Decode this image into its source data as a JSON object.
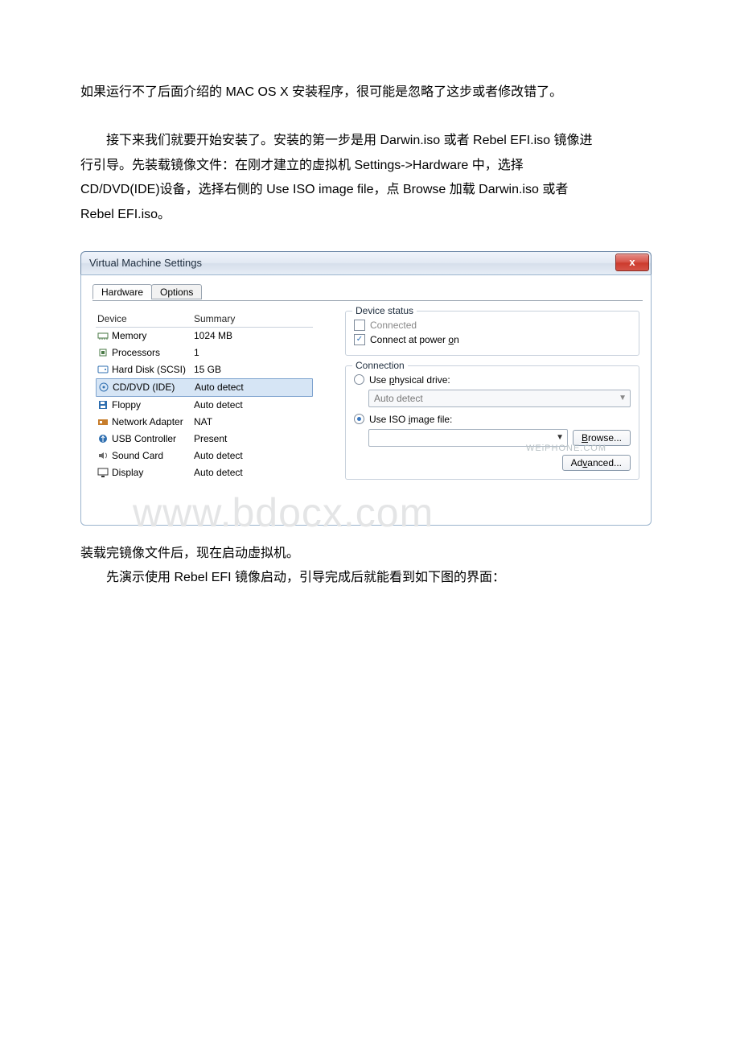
{
  "paragraphs": {
    "p1": "如果运行不了后面介绍的 MAC OS X 安装程序，很可能是忽略了这步或者修改错了。",
    "p2": "接下来我们就要开始安装了。安装的第一步是用 Darwin.iso 或者 Rebel EFI.iso 镜像进行引导。先装载镜像文件：在刚才建立的虚拟机 Settings->Hardware 中，选择 CD/DVD(IDE)设备，选择右侧的 Use ISO image file，点 Browse 加载 Darwin.iso 或者 Rebel EFI.iso。",
    "p3": "装载完镜像文件后，现在启动虚拟机。",
    "p4": "先演示使用 Rebel EFI 镜像启动，引导完成后就能看到如下图的界面："
  },
  "dialog": {
    "title": "Virtual Machine Settings",
    "close_glyph": "x",
    "tabs": {
      "hardware": "Hardware",
      "options": "Options"
    },
    "columns": {
      "device": "Device",
      "summary": "Summary"
    },
    "devices": [
      {
        "name": "Memory",
        "summary": "1024 MB",
        "icon": "memory",
        "color": "#4a7a46"
      },
      {
        "name": "Processors",
        "summary": "1",
        "icon": "cpu",
        "color": "#4a7a46"
      },
      {
        "name": "Hard Disk (SCSI)",
        "summary": "15 GB",
        "icon": "hdd",
        "color": "#2f6fb0"
      },
      {
        "name": "CD/DVD (IDE)",
        "summary": "Auto detect",
        "icon": "cd",
        "color": "#2f6fb0",
        "selected": true
      },
      {
        "name": "Floppy",
        "summary": "Auto detect",
        "icon": "floppy",
        "color": "#2f6fb0"
      },
      {
        "name": "Network Adapter",
        "summary": "NAT",
        "icon": "nic",
        "color": "#c77d2c"
      },
      {
        "name": "USB Controller",
        "summary": "Present",
        "icon": "usb",
        "color": "#2f6fb0"
      },
      {
        "name": "Sound Card",
        "summary": "Auto detect",
        "icon": "sound",
        "color": "#6a6a6a"
      },
      {
        "name": "Display",
        "summary": "Auto detect",
        "icon": "display",
        "color": "#333"
      }
    ],
    "panel": {
      "device_status": {
        "legend": "Device status",
        "connected": "Connected",
        "connect_power": "Connect at power on"
      },
      "connection": {
        "legend": "Connection",
        "physical": "Use physical drive:",
        "physical_value": "Auto detect",
        "iso": "Use ISO image file:",
        "iso_value": "",
        "browse": "Browse...",
        "advanced": "Advanced..."
      }
    },
    "watermark1": "WEiPHONE.COM",
    "watermark2": "www.bdocx.com"
  }
}
